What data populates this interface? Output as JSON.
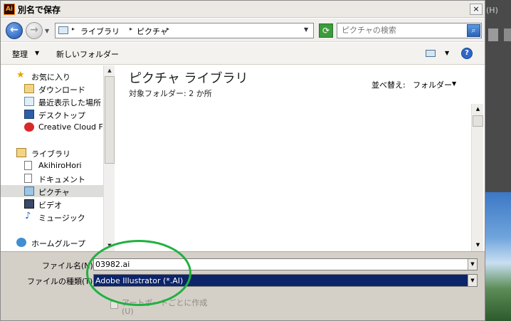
{
  "window": {
    "title": "別名で保存",
    "app_icon": "Ai",
    "close_label": "×"
  },
  "address": {
    "segments": [
      "ライブラリ",
      "ピクチャ"
    ]
  },
  "search": {
    "placeholder": "ピクチャの検索"
  },
  "toolbar": {
    "organize": "整理",
    "new_folder": "新しいフォルダー",
    "help": "?"
  },
  "nav_items": [
    {
      "label": "お気に入り",
      "icon": "star-icon"
    },
    {
      "label": "ダウンロード",
      "icon": "download-folder-icon"
    },
    {
      "label": "最近表示した場所",
      "icon": "recent-places-icon"
    },
    {
      "label": "デスクトップ",
      "icon": "desktop-icon"
    },
    {
      "label": "Creative Cloud Fi",
      "icon": "creative-cloud-icon"
    },
    {
      "label": "ライブラリ",
      "icon": "library-icon"
    },
    {
      "label": "AkihiroHori",
      "icon": "document-icon"
    },
    {
      "label": "ドキュメント",
      "icon": "document-icon"
    },
    {
      "label": "ピクチャ",
      "icon": "pictures-icon",
      "selected": true
    },
    {
      "label": "ビデオ",
      "icon": "video-icon"
    },
    {
      "label": "ミュージック",
      "icon": "music-icon"
    },
    {
      "label": "ホームグループ",
      "icon": "homegroup-icon"
    }
  ],
  "content": {
    "library_title": "ピクチャ ライブラリ",
    "library_subtitle": "対象フォルダー: 2 か所",
    "arrange_label": "並べ替え:",
    "arrange_value": "フォルダー"
  },
  "form": {
    "filename_label": "ファイル名(N):",
    "filename_value": "03982.ai",
    "filetype_label": "ファイルの種類(T):",
    "filetype_value": "Adobe Illustrator (*.AI)",
    "artboard_label_line1": "アートボードごとに作成",
    "artboard_label_line2": "(U)"
  },
  "side": {
    "menu_hint": "(H)"
  },
  "colors": {
    "selection": "#0c246a",
    "annotation": "#20b040"
  }
}
